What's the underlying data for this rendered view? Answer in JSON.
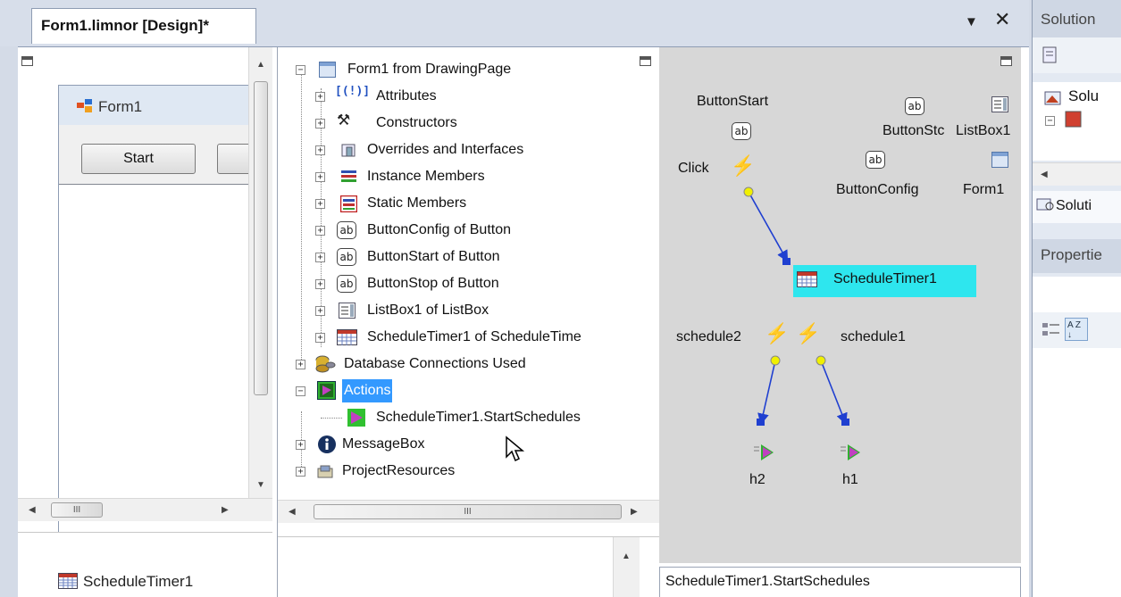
{
  "document_tab": {
    "title": "Form1.limnor [Design]*"
  },
  "form_preview": {
    "title": "Form1",
    "buttons": [
      "Start"
    ]
  },
  "component_tray": {
    "item": "ScheduleTimer1"
  },
  "tree": {
    "items": [
      {
        "label": "Form1 from DrawingPage"
      },
      {
        "label": "Attributes"
      },
      {
        "label": "Constructors"
      },
      {
        "label": "Overrides and Interfaces"
      },
      {
        "label": "Instance Members"
      },
      {
        "label": "Static Members"
      },
      {
        "label": "ButtonConfig of Button"
      },
      {
        "label": "ButtonStart of Button"
      },
      {
        "label": "ButtonStop of Button"
      },
      {
        "label": "ListBox1 of ListBox"
      },
      {
        "label": "ScheduleTimer1 of ScheduleTime"
      },
      {
        "label": "Database Connections Used"
      },
      {
        "label": "Actions"
      },
      {
        "label": "ScheduleTimer1.StartSchedules"
      },
      {
        "label": "MessageBox"
      },
      {
        "label": "ProjectResources"
      }
    ],
    "hscroll_grip": "III"
  },
  "flow": {
    "button_start": "ButtonStart",
    "button_stop": "ButtonStc",
    "listbox": "ListBox1",
    "click_event": "Click",
    "button_config": "ButtonConfig",
    "form": "Form1",
    "timer": "ScheduleTimer1",
    "schedule2": "schedule2",
    "schedule1": "schedule1",
    "h2": "h2",
    "h1": "h1",
    "ab_glyph": "ab",
    "status": "ScheduleTimer1.StartSchedules"
  },
  "form_hscroll_grip": "III",
  "solution_panel": {
    "title": "Solution",
    "item1": "Solu",
    "tab_label": "Soluti"
  },
  "properties_panel": {
    "title": "Propertie",
    "sort_az": "A Z"
  },
  "colors": {
    "selection": "#3399ff",
    "timer_highlight": "#2ee6ee",
    "flow_arrow": "#1f3fd0",
    "event_dot": "#f0f000"
  }
}
